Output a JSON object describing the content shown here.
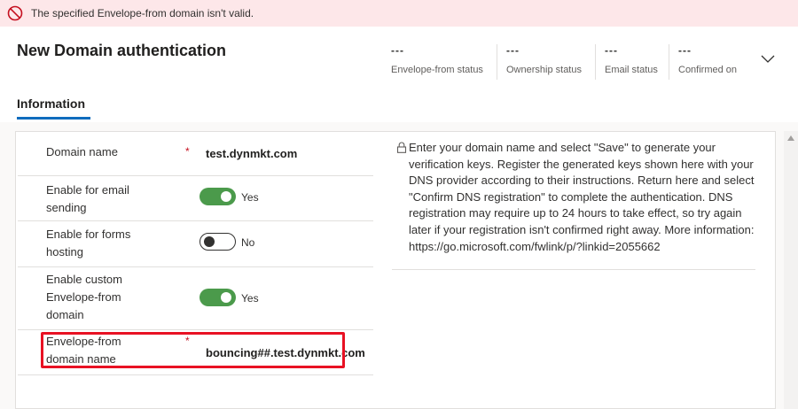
{
  "error_bar": {
    "message": "The specified Envelope-from domain isn't valid.",
    "icon": "blocked-circle-icon",
    "color": "#c50f1f"
  },
  "header": {
    "title": "New Domain authentication",
    "statuses": [
      {
        "value": "---",
        "label": "Envelope-from status"
      },
      {
        "value": "---",
        "label": "Ownership status"
      },
      {
        "value": "---",
        "label": "Email status"
      },
      {
        "value": "---",
        "label": "Confirmed on"
      }
    ],
    "expand_icon": "chevron-down-icon"
  },
  "tabs": {
    "active": "Information"
  },
  "form": {
    "domain_name": {
      "label": "Domain name",
      "required": "*",
      "value": "test.dynmkt.com"
    },
    "email_sending": {
      "label_line1": "Enable for email",
      "label_line2": "sending",
      "state": "Yes"
    },
    "forms_hosting": {
      "label_line1": "Enable for forms",
      "label_line2": "hosting",
      "state": "No"
    },
    "custom_envelope": {
      "label_line1": "Enable custom",
      "label_line2": "Envelope-from",
      "label_line3": "domain",
      "state": "Yes"
    },
    "envelope_domain": {
      "label_line1": "Envelope-from",
      "label_line2": "domain name",
      "required": "*",
      "value": "bouncing##.test.dynmkt.com"
    }
  },
  "info": {
    "icon": "lock-icon",
    "text": "Enter your domain name and select \"Save\" to generate your verification keys. Register the generated keys shown here with your DNS provider according to their instructions. Return here and select \"Confirm DNS registration\" to complete the authentication. DNS registration may require up to 24 hours to take effect, so try again later if your registration isn't confirmed right away. More information: https://go.microsoft.com/fwlink/p/?linkid=2055662"
  },
  "colors": {
    "error_background": "#fde7e9",
    "toggle_on": "#4b9a4b",
    "tab_accent": "#0f6cbd",
    "highlight": "#e81123"
  }
}
